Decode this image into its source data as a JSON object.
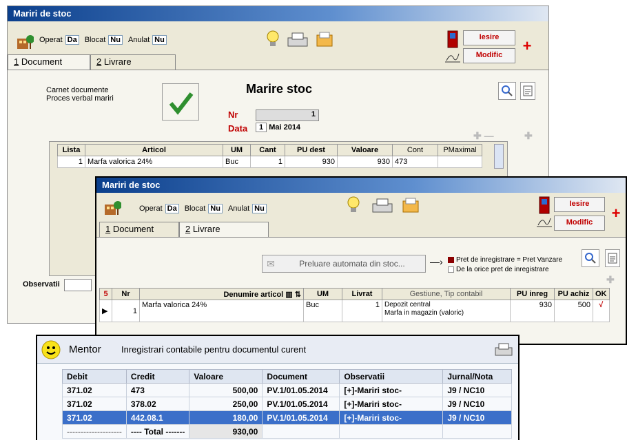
{
  "win1": {
    "title": "Mariri de stoc",
    "operat_label": "Operat",
    "operat_val": "Da",
    "blocat_label": "Blocat",
    "blocat_val": "Nu",
    "anulat_label": "Anulat",
    "anulat_val": "Nu",
    "tab1_num": "1",
    "tab1_label": "Document",
    "tab2_num": "2",
    "tab2_label": "Livrare",
    "iesire": "Iesire",
    "modific": "Modific",
    "carnet_line1": "Carnet documente",
    "carnet_line2": "Proces verbal mariri",
    "doc_title": "Marire stoc",
    "nr_label": "Nr",
    "nr_val": "1",
    "data_label": "Data",
    "data_day": "1",
    "data_rest": "Mai 2014",
    "observatii_label": "Observatii",
    "headers": [
      "Lista",
      "Articol",
      "UM",
      "Cant",
      "PU dest",
      "Valoare",
      "Cont",
      "PMaximal"
    ],
    "row": [
      "1",
      "Marfa valorica 24%",
      "Buc",
      "1",
      "930",
      "930",
      "473",
      ""
    ]
  },
  "win2": {
    "title": "Mariri de stoc",
    "operat_label": "Operat",
    "operat_val": "Da",
    "blocat_label": "Blocat",
    "blocat_val": "Nu",
    "anulat_label": "Anulat",
    "anulat_val": "Nu",
    "tab1_num": "1",
    "tab1_label": "Document",
    "tab2_num": "2",
    "tab2_label": "Livrare",
    "iesire": "Iesire",
    "modific": "Modific",
    "preluare": "Preluare automata din stoc...",
    "opt1": "Pret de inregistrare = Pret Vanzare",
    "opt2": "De la orice pret de inregistrare",
    "count": "5",
    "headers": [
      "Nr",
      "Denumire articol",
      "UM",
      "Livrat",
      "Gestiune, Tip contabil",
      "PU inreg",
      "PU achiz",
      "OK"
    ],
    "row": {
      "nr": "1",
      "den": "Marfa valorica 24%",
      "um": "Buc",
      "livrat": "1",
      "gest1": "Depozit central",
      "gest2": "Marfa in magazin (valoric)",
      "pu_inreg": "930",
      "pu_achiz": "500",
      "ok": "√"
    }
  },
  "mentor": {
    "app": "Mentor",
    "title": "Inregistrari contabile pentru documentul curent",
    "headers": [
      "Debit",
      "Credit",
      "Valoare",
      "Document",
      "Observatii",
      "Jurnal/Nota"
    ],
    "rows": [
      [
        "371.02",
        "473",
        "500,00",
        "PV.1/01.05.2014",
        "[+]-Mariri stoc-",
        "J9 / NC10"
      ],
      [
        "371.02",
        "378.02",
        "250,00",
        "PV.1/01.05.2014",
        "[+]-Mariri stoc-",
        "J9 / NC10"
      ],
      [
        "371.02",
        "442.08.1",
        "180,00",
        "PV.1/01.05.2014",
        "[+]-Mariri stoc-",
        "J9 / NC10"
      ]
    ],
    "total_debit": "--------------------",
    "total_label": "---- Total -------",
    "total_val": "930,00"
  },
  "colors": {
    "title_blue": "#0b3f8c",
    "accent_red": "#c00000",
    "selection": "#3b6fc9"
  },
  "icons": [
    "building-icon",
    "lightbulb-icon",
    "printer-icon",
    "folder-icon",
    "door-exit-icon",
    "signature-icon",
    "magnifier-icon",
    "document-icon",
    "smiley-icon"
  ]
}
